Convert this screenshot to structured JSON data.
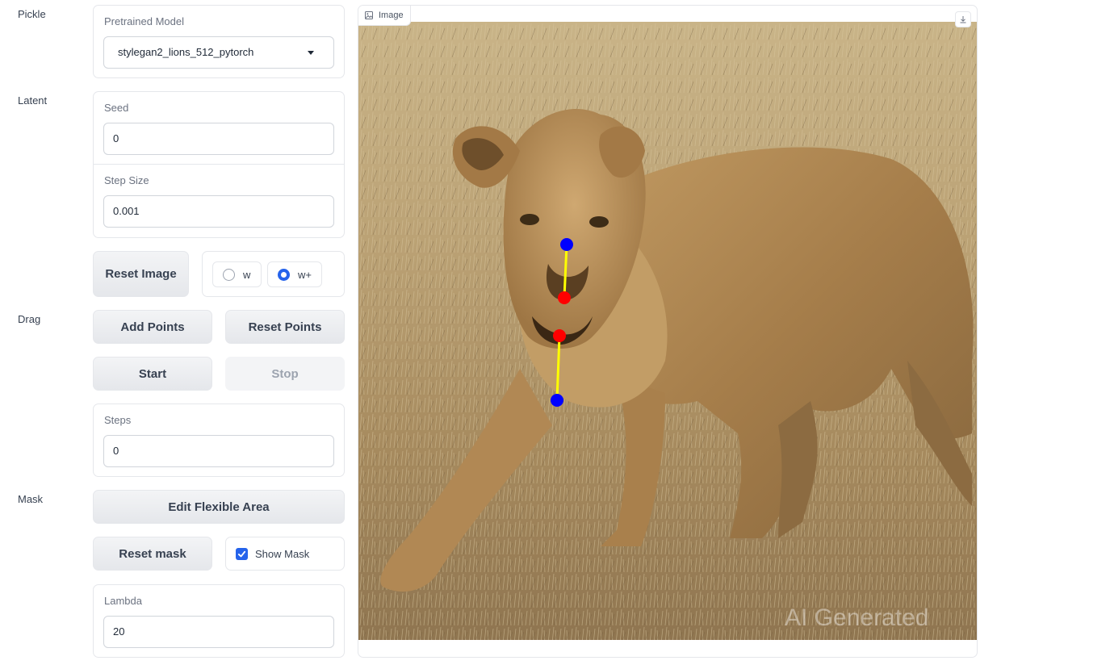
{
  "sections": {
    "pickle": "Pickle",
    "latent": "Latent",
    "drag": "Drag",
    "mask": "Mask"
  },
  "pretrained_model": {
    "label": "Pretrained Model",
    "value": "stylegan2_lions_512_pytorch"
  },
  "seed": {
    "label": "Seed",
    "value": "0"
  },
  "step_size": {
    "label": "Step Size",
    "value": "0.001"
  },
  "reset_image_label": "Reset Image",
  "latent_space": {
    "options": [
      "w",
      "w+"
    ],
    "selected": "w+"
  },
  "drag": {
    "add_points_label": "Add Points",
    "reset_points_label": "Reset Points",
    "start_label": "Start",
    "stop_label": "Stop"
  },
  "steps": {
    "label": "Steps",
    "value": "0"
  },
  "mask": {
    "edit_flexible_area_label": "Edit Flexible Area",
    "reset_mask_label": "Reset mask",
    "show_mask_label": "Show Mask",
    "show_mask_checked": true
  },
  "lambda": {
    "label": "Lambda",
    "value": "20"
  },
  "image_panel": {
    "tag_label": "Image",
    "watermark": "AI Generated",
    "handle_color": "#ff0000",
    "target_color": "#0000ff",
    "line_color": "#ffff00"
  },
  "colors": {
    "accent": "#2563eb",
    "border": "#e5e7eb"
  }
}
